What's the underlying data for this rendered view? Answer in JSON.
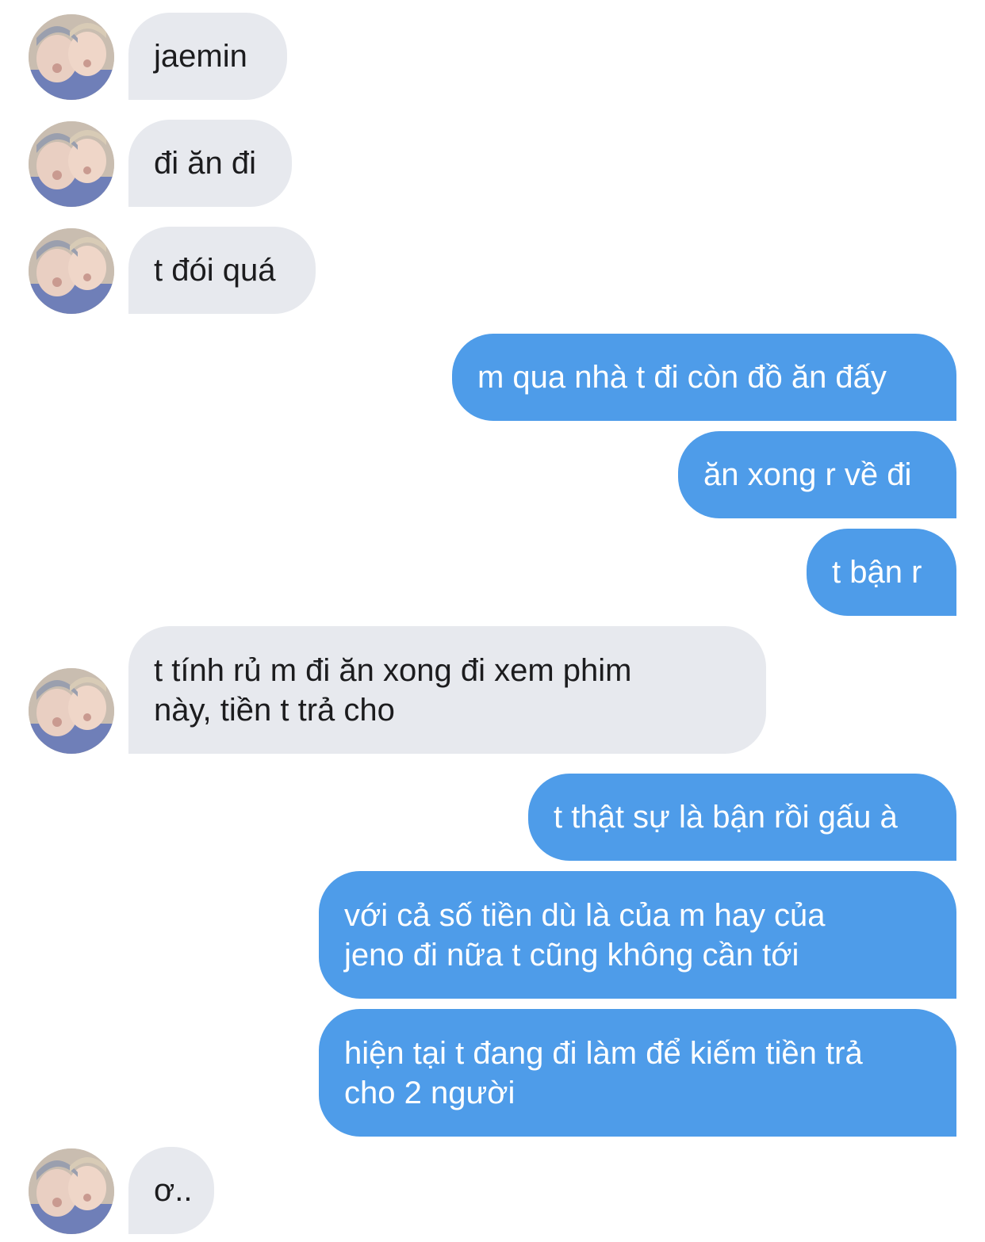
{
  "conversation": {
    "messages": [
      {
        "sender": "them",
        "text": "jaemin"
      },
      {
        "sender": "them",
        "text": "đi ăn đi"
      },
      {
        "sender": "them",
        "text": "t đói quá"
      },
      {
        "sender": "me",
        "text": "m qua nhà t đi còn đồ ăn đấy"
      },
      {
        "sender": "me",
        "text": "ăn xong r về đi"
      },
      {
        "sender": "me",
        "text": "t bận r"
      },
      {
        "sender": "them",
        "text": "t tính rủ m đi ăn xong đi xem phim\nnày, tiền t trả cho"
      },
      {
        "sender": "me",
        "text": "t thật sự là bận rồi gấu à"
      },
      {
        "sender": "me",
        "text": "với cả số tiền dù là của m hay của\njeno đi nữa t cũng không cần tới"
      },
      {
        "sender": "me",
        "text": "hiện tại t đang đi làm để kiếm tiền trả\ncho 2 người"
      },
      {
        "sender": "them",
        "text": "ơ.."
      }
    ]
  },
  "colors": {
    "incoming_bubble": "#e7e9ee",
    "incoming_text": "#1c1c1e",
    "outgoing_bubble": "#4e9ce9",
    "outgoing_text": "#ffffff"
  },
  "icons": {
    "contact_avatar": "contact-avatar-photo"
  }
}
